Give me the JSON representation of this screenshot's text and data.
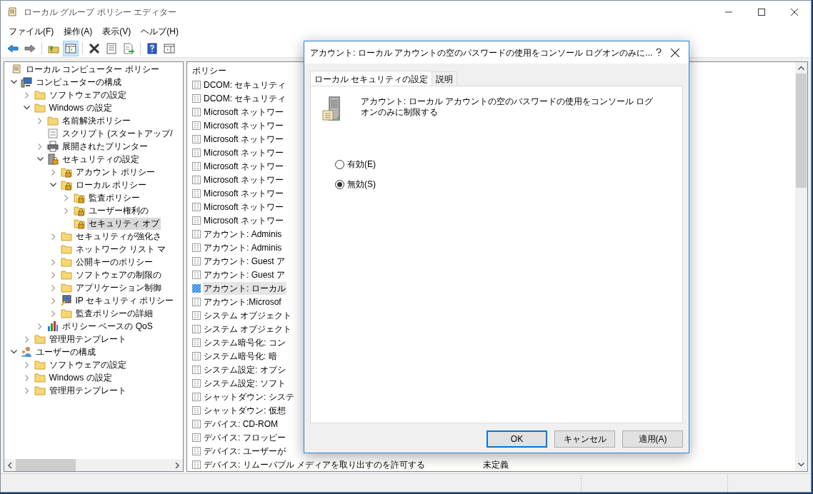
{
  "window": {
    "title": "ローカル グループ ポリシー エディター"
  },
  "menu": [
    "ファイル(F)",
    "操作(A)",
    "表示(V)",
    "ヘルプ(H)"
  ],
  "toolbar": [
    {
      "kind": "back",
      "pressed": false
    },
    {
      "kind": "forward",
      "pressed": false
    },
    {
      "kind": "sep"
    },
    {
      "kind": "up",
      "pressed": false
    },
    {
      "kind": "tree",
      "pressed": true
    },
    {
      "kind": "sep"
    },
    {
      "kind": "delete",
      "pressed": false
    },
    {
      "kind": "properties",
      "pressed": false
    },
    {
      "kind": "export",
      "pressed": false
    },
    {
      "kind": "sep"
    },
    {
      "kind": "help",
      "pressed": false
    },
    {
      "kind": "actionpane",
      "pressed": false
    }
  ],
  "tree": [
    {
      "label": "ローカル コンピューター ポリシー",
      "kind": "scroll",
      "selected": false,
      "children": [
        {
          "label": "コンピューターの構成",
          "kind": "computer",
          "expanded": true,
          "selected": false,
          "children": [
            {
              "label": "ソフトウェアの設定",
              "kind": "folder",
              "expanded": false,
              "selected": false
            },
            {
              "label": "Windows の設定",
              "kind": "folder",
              "expanded": true,
              "selected": false,
              "children": [
                {
                  "label": "名前解決ポリシー",
                  "kind": "folder",
                  "expanded": false,
                  "selected": false
                },
                {
                  "label": "スクリプト (スタートアップ/",
                  "kind": "script",
                  "selected": false
                },
                {
                  "label": "展開されたプリンター",
                  "kind": "printer",
                  "expanded": false,
                  "selected": false
                },
                {
                  "label": "セキュリティの設定",
                  "kind": "server",
                  "expanded": true,
                  "selected": false,
                  "children": [
                    {
                      "label": "アカウント ポリシー",
                      "kind": "lockfolder",
                      "expanded": false,
                      "selected": false
                    },
                    {
                      "label": "ローカル ポリシー",
                      "kind": "lockfolder",
                      "expanded": true,
                      "selected": false,
                      "children": [
                        {
                          "label": "監査ポリシー",
                          "kind": "lockfolder",
                          "expanded": false,
                          "selected": false
                        },
                        {
                          "label": "ユーザー権利の",
                          "kind": "lockfolder",
                          "expanded": false,
                          "selected": false
                        },
                        {
                          "label": "セキュリティ オプ",
                          "kind": "lockfolder",
                          "selected": true
                        }
                      ]
                    },
                    {
                      "label": "セキュリティが強化さ",
                      "kind": "folder",
                      "expanded": false,
                      "selected": false
                    },
                    {
                      "label": "ネットワーク リスト マ",
                      "kind": "folder",
                      "selected": false
                    },
                    {
                      "label": "公開キーのポリシー",
                      "kind": "folder",
                      "expanded": false,
                      "selected": false
                    },
                    {
                      "label": "ソフトウェアの制限の",
                      "kind": "folder",
                      "expanded": false,
                      "selected": false
                    },
                    {
                      "label": "アプリケーション制御",
                      "kind": "folder",
                      "expanded": false,
                      "selected": false
                    },
                    {
                      "label": "IP セキュリティ ポリシー",
                      "kind": "ip",
                      "expanded": false,
                      "selected": false
                    },
                    {
                      "label": "監査ポリシーの詳細",
                      "kind": "folder",
                      "expanded": false,
                      "selected": false
                    }
                  ]
                },
                {
                  "label": "ポリシー ベースの QoS",
                  "kind": "chart",
                  "expanded": false,
                  "selected": false
                }
              ]
            },
            {
              "label": "管理用テンプレート",
              "kind": "folder",
              "expanded": false,
              "selected": false
            }
          ]
        },
        {
          "label": "ユーザーの構成",
          "kind": "user",
          "expanded": true,
          "selected": false,
          "children": [
            {
              "label": "ソフトウェアの設定",
              "kind": "folder",
              "expanded": false,
              "selected": false
            },
            {
              "label": "Windows の設定",
              "kind": "folder",
              "expanded": false,
              "selected": false
            },
            {
              "label": "管理用テンプレート",
              "kind": "folder",
              "expanded": false,
              "selected": false
            }
          ]
        }
      ]
    }
  ],
  "list": {
    "column": "ポリシー",
    "rows": [
      {
        "label": "DCOM: セキュリティ",
        "selected": false
      },
      {
        "label": "DCOM: セキュリティ",
        "selected": false
      },
      {
        "label": "Microsoft ネットワー",
        "selected": false
      },
      {
        "label": "Microsoft ネットワー",
        "selected": false
      },
      {
        "label": "Microsoft ネットワー",
        "selected": false
      },
      {
        "label": "Microsoft ネットワー",
        "selected": false
      },
      {
        "label": "Microsoft ネットワー",
        "selected": false
      },
      {
        "label": "Microsoft ネットワー",
        "selected": false
      },
      {
        "label": "Microsoft ネットワー",
        "selected": false
      },
      {
        "label": "Microsoft ネットワー",
        "selected": false
      },
      {
        "label": "Microsoft ネットワー",
        "selected": false
      },
      {
        "label": "アカウント: Adminis",
        "selected": false
      },
      {
        "label": "アカウント: Adminis",
        "selected": false
      },
      {
        "label": "アカウント: Guest ア",
        "selected": false
      },
      {
        "label": "アカウント: Guest ア",
        "selected": false
      },
      {
        "label": "アカウント: ローカル",
        "selected": true
      },
      {
        "label": "アカウント:Microsof",
        "selected": false
      },
      {
        "label": "システム オブジェクト",
        "selected": false
      },
      {
        "label": "システム オブジェクト",
        "selected": false
      },
      {
        "label": "システム暗号化: コン",
        "selected": false
      },
      {
        "label": "システム暗号化: 暗",
        "selected": false
      },
      {
        "label": "システム設定: オプシ",
        "selected": false
      },
      {
        "label": "システム設定: ソフト",
        "selected": false
      },
      {
        "label": "シャットダウン: システ",
        "selected": false
      },
      {
        "label": "シャットダウン: 仮想",
        "selected": false
      },
      {
        "label": "デバイス: CD-ROM",
        "selected": false
      },
      {
        "label": "デバイス: フロッピー",
        "selected": false
      },
      {
        "label": "デバイス: ユーザーが",
        "selected": false
      },
      {
        "label": "デバイス: リムーバブル メディアを取り出すのを許可する",
        "value": "未定義",
        "selected": false
      }
    ]
  },
  "dialog": {
    "title": "アカウント: ローカル アカウントの空のパスワードの使用をコンソール ログオンのみに...",
    "tabs": [
      {
        "label": "ローカル セキュリティの設定",
        "selected": true
      },
      {
        "label": "説明",
        "selected": false
      }
    ],
    "description": "アカウント: ローカル アカウントの空のパスワードの使用をコンソール ログオンのみに制限する",
    "options": [
      {
        "label": "有効(E)",
        "selected": false
      },
      {
        "label": "無効(S)",
        "selected": true
      }
    ],
    "buttons": [
      {
        "label": "OK",
        "default": true
      },
      {
        "label": "キャンセル",
        "default": false
      },
      {
        "label": "適用(A)",
        "default": false
      }
    ]
  }
}
